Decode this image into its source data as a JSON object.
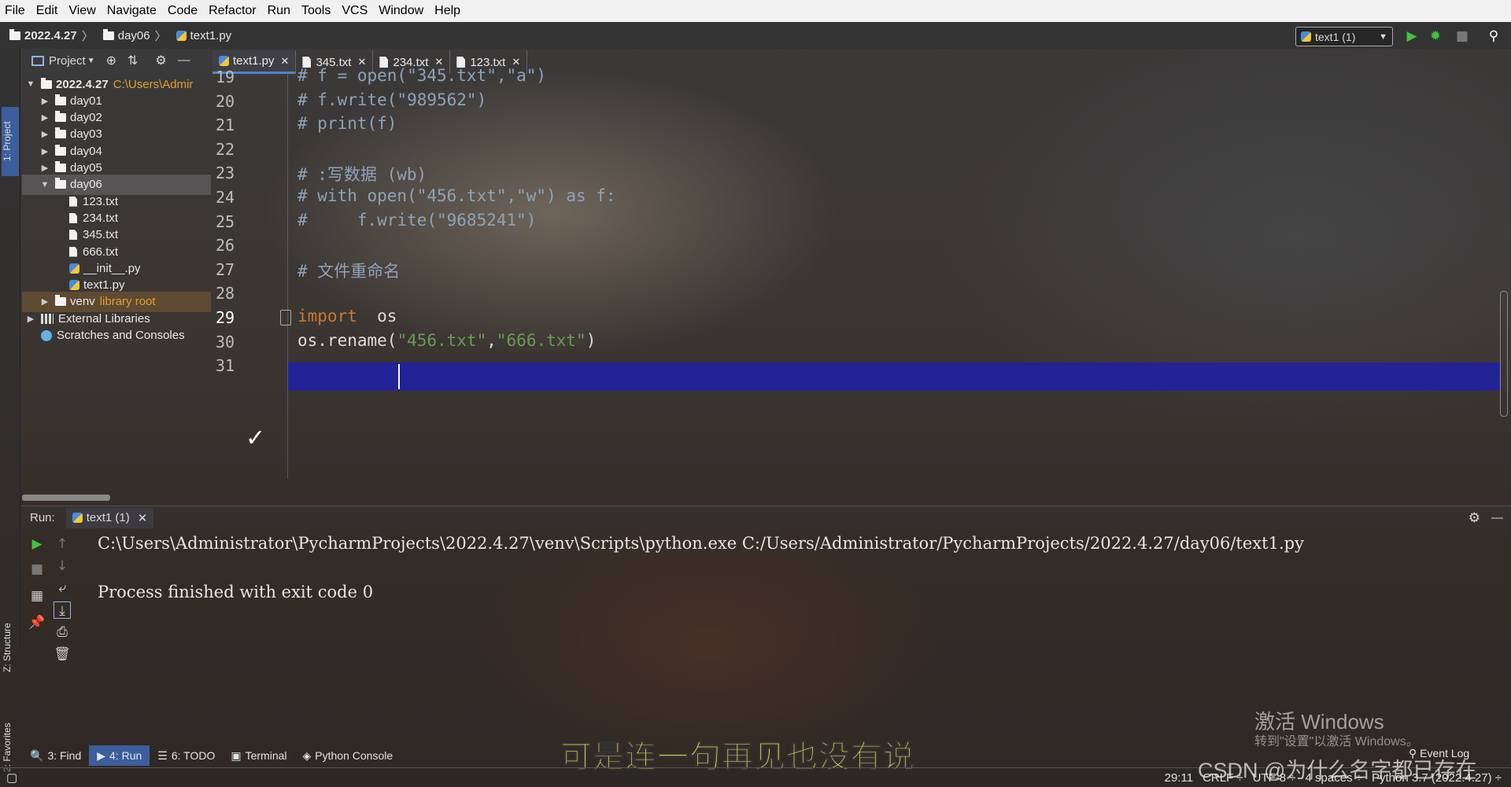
{
  "menu": [
    "File",
    "Edit",
    "View",
    "Navigate",
    "Code",
    "Refactor",
    "Run",
    "Tools",
    "VCS",
    "Window",
    "Help"
  ],
  "breadcrumbs": [
    "2022.4.27",
    "day06",
    "text1.py"
  ],
  "run_config": "text1 (1)",
  "side_tabs": {
    "project": "1: Project",
    "structure": "Z: Structure",
    "favorites": "2: Favorites"
  },
  "project_panel": {
    "title": "Project"
  },
  "tree": [
    {
      "label": "2022.4.27",
      "hint": "C:\\Users\\Admir",
      "level": 0,
      "arrow": "▼",
      "type": "folder"
    },
    {
      "label": "day01",
      "level": 1,
      "arrow": "▶",
      "type": "folder"
    },
    {
      "label": "day02",
      "level": 1,
      "arrow": "▶",
      "type": "folder"
    },
    {
      "label": "day03",
      "level": 1,
      "arrow": "▶",
      "type": "folder"
    },
    {
      "label": "day04",
      "level": 1,
      "arrow": "▶",
      "type": "folder"
    },
    {
      "label": "day05",
      "level": 1,
      "arrow": "▶",
      "type": "folder"
    },
    {
      "label": "day06",
      "level": 1,
      "arrow": "▼",
      "type": "folder",
      "selected": true
    },
    {
      "label": "123.txt",
      "level": 2,
      "arrow": "",
      "type": "file"
    },
    {
      "label": "234.txt",
      "level": 2,
      "arrow": "",
      "type": "file"
    },
    {
      "label": "345.txt",
      "level": 2,
      "arrow": "",
      "type": "file"
    },
    {
      "label": "666.txt",
      "level": 2,
      "arrow": "",
      "type": "file"
    },
    {
      "label": "__init__.py",
      "level": 2,
      "arrow": "",
      "type": "py"
    },
    {
      "label": "text1.py",
      "level": 2,
      "arrow": "",
      "type": "py"
    },
    {
      "label": "venv",
      "hint": "library root",
      "level": 1,
      "arrow": "▶",
      "type": "folder",
      "venv": true
    },
    {
      "label": "External Libraries",
      "level": 0,
      "arrow": "▶",
      "type": "lib"
    },
    {
      "label": "Scratches and Consoles",
      "level": 0,
      "arrow": "",
      "type": "scratch"
    }
  ],
  "editor_tabs": [
    {
      "label": "text1.py",
      "active": true,
      "type": "py"
    },
    {
      "label": "345.txt",
      "type": "txt"
    },
    {
      "label": "234.txt",
      "type": "txt"
    },
    {
      "label": "123.txt",
      "type": "txt"
    }
  ],
  "code_lines": [
    {
      "n": "19",
      "parts": [
        [
          "cmt",
          "# f = open(\"345.txt\",\"a\")"
        ]
      ]
    },
    {
      "n": "20",
      "parts": [
        [
          "cmt",
          "# f.write(\"989562\")"
        ]
      ]
    },
    {
      "n": "21",
      "parts": [
        [
          "cmt",
          "# print(f)"
        ]
      ]
    },
    {
      "n": "22",
      "parts": []
    },
    {
      "n": "23",
      "parts": [
        [
          "cmt",
          "# :写数据 (wb)"
        ]
      ]
    },
    {
      "n": "24",
      "parts": [
        [
          "cmt",
          "# with open(\"456.txt\",\"w\") as f:"
        ]
      ]
    },
    {
      "n": "25",
      "parts": [
        [
          "cmt",
          "#     f.write(\"9685241\")"
        ]
      ]
    },
    {
      "n": "26",
      "parts": []
    },
    {
      "n": "27",
      "parts": [
        [
          "cmt",
          "# 文件重命名"
        ]
      ]
    },
    {
      "n": "28",
      "parts": []
    },
    {
      "n": "29",
      "parts": [
        [
          "kw",
          "import"
        ],
        [
          "plain",
          "  os"
        ]
      ]
    },
    {
      "n": "30",
      "parts": [
        [
          "plain",
          "os.rename("
        ],
        [
          "str",
          "\"456.txt\""
        ],
        [
          "plain",
          ","
        ],
        [
          "str",
          "\"666.txt\""
        ],
        [
          "plain",
          ")"
        ]
      ]
    },
    {
      "n": "31",
      "parts": []
    }
  ],
  "run_panel": {
    "label": "Run:",
    "tab": "text1 (1)"
  },
  "console_lines": [
    "C:\\Users\\Administrator\\PycharmProjects\\2022.4.27\\venv\\Scripts\\python.exe C:/Users/Administrator/PycharmProjects/2022.4.27/day06/text1.py",
    "",
    "Process finished with exit code 0"
  ],
  "bottom_tabs": [
    {
      "label": "3: Find",
      "icon": "🔍"
    },
    {
      "label": "4: Run",
      "icon": "▶",
      "active": true
    },
    {
      "label": "6: TODO",
      "icon": "☰"
    },
    {
      "label": "Terminal",
      "icon": "▣"
    },
    {
      "label": "Python Console",
      "icon": "◈"
    }
  ],
  "subtitle": "可是连一句再见也没有说",
  "windows_watermark": {
    "line1": "激活 Windows",
    "line2": "转到\"设置\"以激活 Windows。"
  },
  "event_log": "Event Log",
  "status": [
    "29:11",
    "CRLF ÷",
    "UTF-8 ÷",
    "4 spaces ÷",
    "Python 3.7 (2022.4.27) ÷"
  ],
  "csdn_watermark": "CSDN @为什么名字都已存在",
  "colors": {
    "accent": "#3d5e9c",
    "caret_line": "#2020a8",
    "keyword": "#cc7832",
    "string": "#6a9a55",
    "comment": "#8fa2b8",
    "subtitle": "#f6e24a"
  }
}
